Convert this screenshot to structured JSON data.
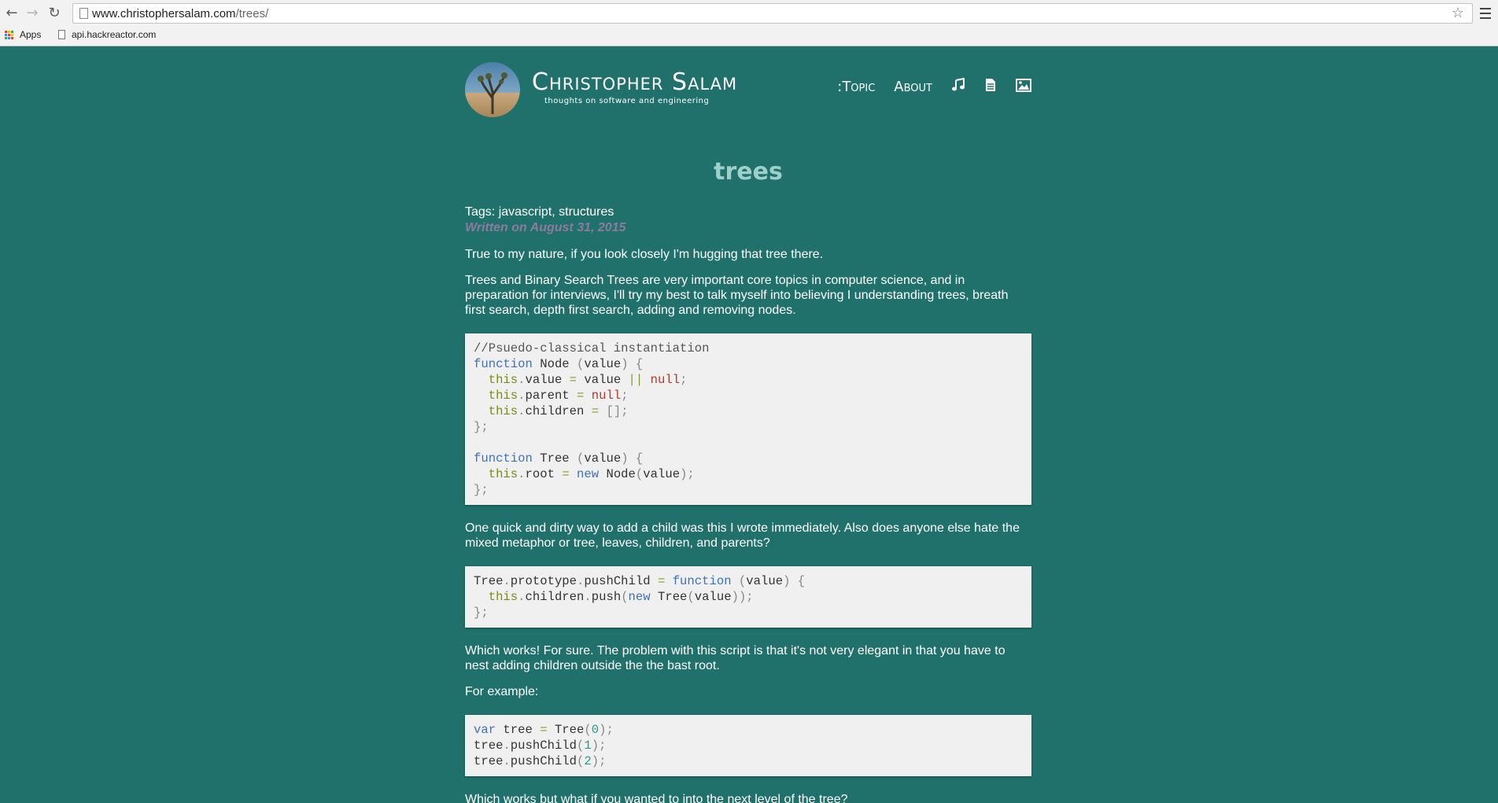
{
  "browser": {
    "url_host": "www.christophersalam.com",
    "url_path": "/trees/",
    "bookmarks": [
      {
        "label": "Apps"
      },
      {
        "label": "api.hackreactor.com"
      }
    ]
  },
  "site": {
    "title": "Christopher Salam",
    "tagline": "thoughts on software and engineering",
    "nav": [
      {
        "label": ":Topic"
      },
      {
        "label": "About"
      }
    ],
    "nav_icons": [
      "music-icon",
      "document-icon",
      "image-icon"
    ]
  },
  "post": {
    "title": "trees",
    "tags": "Tags: javascript, structures",
    "date": "Written on August 31, 2015",
    "p1": "True to my nature, if you look closely I'm hugging that tree there.",
    "p2": "Trees and Binary Search Trees are very important core topics in computer science, and in preparation for interviews, I'll try my best to talk myself into believing I understanding trees, breath first search, depth first search, adding and removing nodes.",
    "p3": "One quick and dirty way to add a child was this I wrote immediately. Also does anyone else hate the mixed metaphor or tree, leaves, children, and parents?",
    "p4": "Which works! For sure. The problem with this script is that it's not very elegant in that you have to nest adding children outside the the bast root.",
    "p5": "For example:",
    "p6": "Which works but what if you wanted to into the next level of the tree?"
  },
  "code_blocks": [
    "//Psuedo-classical instantiation\nfunction Node (value) {\n  this.value = value || null;\n  this.parent = null;\n  this.children = [];\n};\n\nfunction Tree (value) {\n  this.root = new Node(value);\n};",
    "Tree.prototype.pushChild = function (value) {\n  this.children.push(new Tree(value));\n};",
    "var tree = Tree(0);\ntree.pushChild(1);\ntree.pushChild(2);"
  ],
  "colors": {
    "page_background": "#20706b",
    "title_color": "#9fcfcb",
    "date_color": "#8c7aa0",
    "code_background": "#f0f0f0"
  }
}
